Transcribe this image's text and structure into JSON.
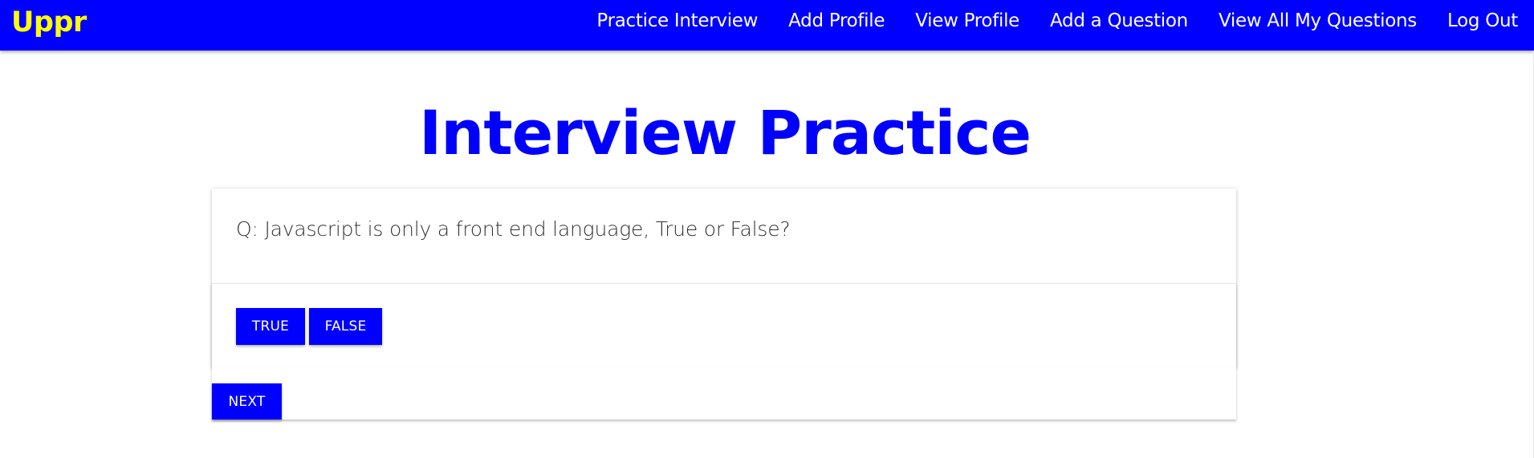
{
  "navbar": {
    "brand": "Uppr",
    "links": [
      "Practice Interview",
      "Add Profile",
      "View Profile",
      "Add a Question",
      "View All My Questions",
      "Log Out"
    ]
  },
  "page": {
    "title": "Interview Practice"
  },
  "question": {
    "text": "Q: Javascript is only a front end language, True or False?"
  },
  "answers": {
    "true_label": "TRUE",
    "false_label": "FALSE"
  },
  "footer": {
    "next_label": "NEXT"
  },
  "colors": {
    "navbar_bg": "#0000ff",
    "brand": "#ffff00",
    "accent": "#0000ff"
  }
}
